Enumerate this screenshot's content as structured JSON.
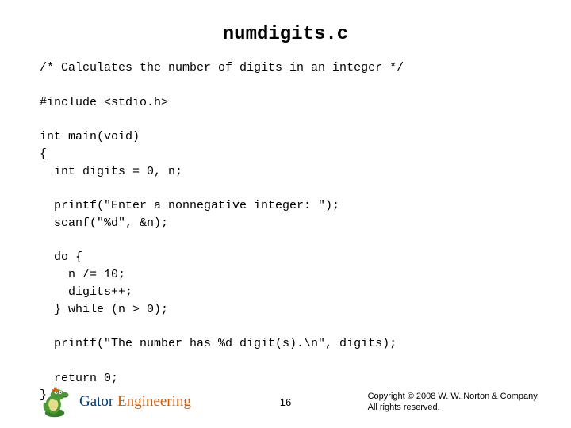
{
  "title": "numdigits.c",
  "code": "/* Calculates the number of digits in an integer */\n\n#include <stdio.h>\n\nint main(void)\n{\n  int digits = 0, n;\n\n  printf(\"Enter a nonnegative integer: \");\n  scanf(\"%d\", &n);\n\n  do {\n    n /= 10;\n    digits++;\n  } while (n > 0);\n\n  printf(\"The number has %d digit(s).\\n\", digits);\n\n  return 0;\n}",
  "footer": {
    "brand1": "Gator ",
    "brand2": "Engineering",
    "page": "16",
    "copyright_line1": "Copyright © 2008 W. W. Norton & Company.",
    "copyright_line2": "All rights reserved."
  }
}
